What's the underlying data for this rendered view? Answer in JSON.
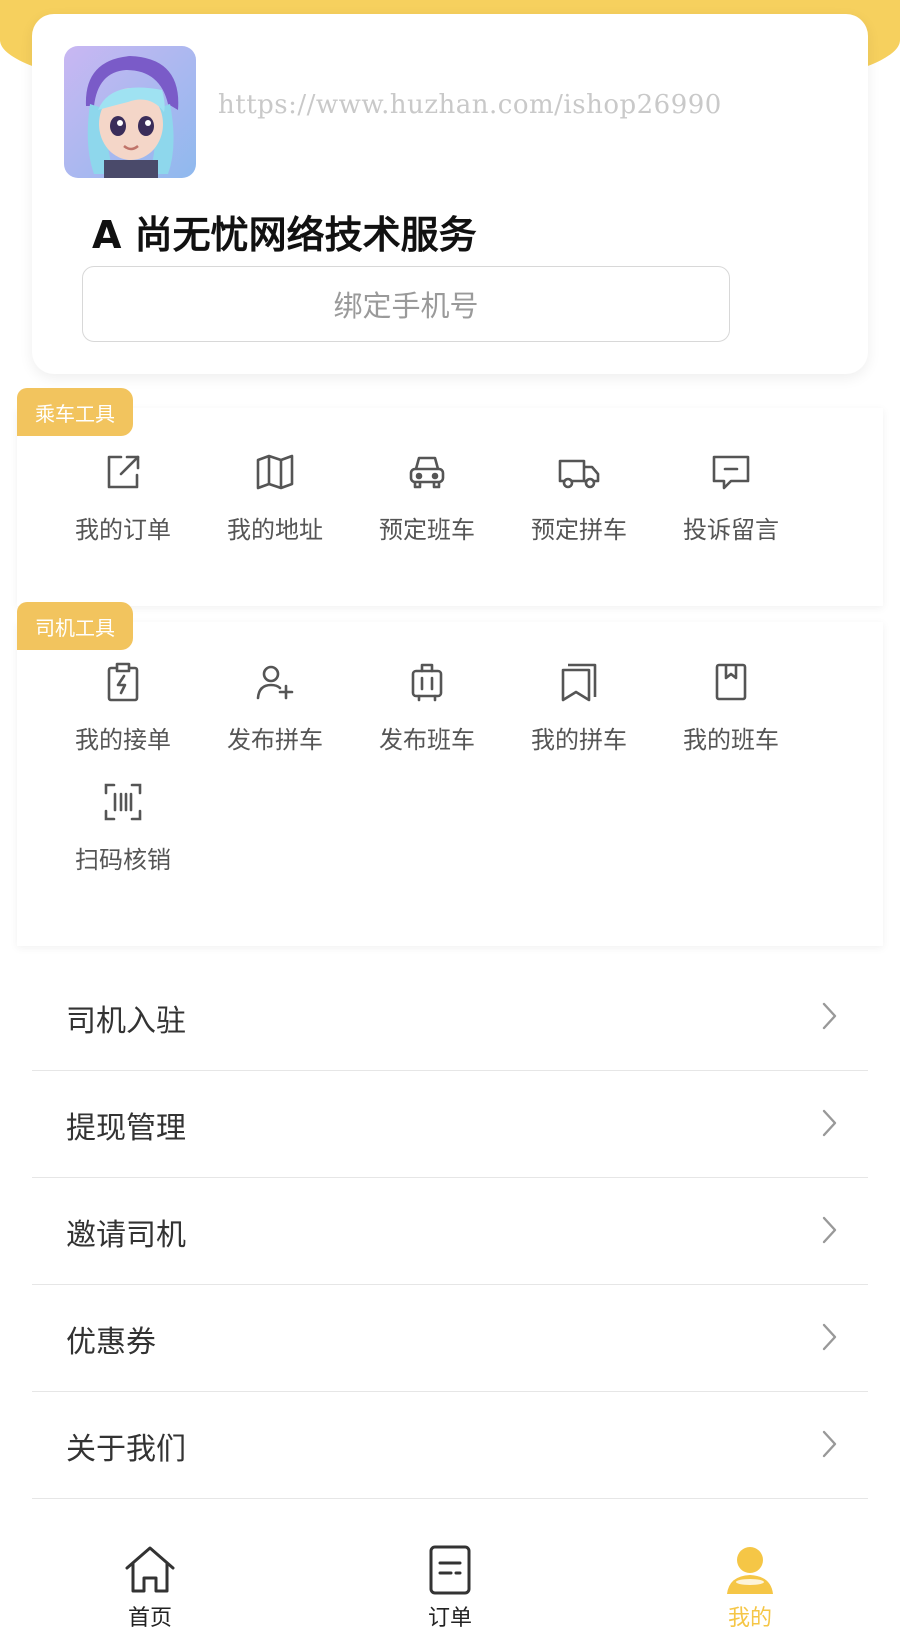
{
  "profile": {
    "watermark": "https://www.huzhan.com/ishop26990",
    "user_name": "A 尚无忧网络技术服务",
    "bind_phone_label": "绑定手机号"
  },
  "passenger_tools": {
    "title": "乘车工具",
    "items": [
      {
        "label": "我的订单",
        "icon": "external-link-icon"
      },
      {
        "label": "我的地址",
        "icon": "map-icon"
      },
      {
        "label": "预定班车",
        "icon": "car-icon"
      },
      {
        "label": "预定拼车",
        "icon": "truck-icon"
      },
      {
        "label": "投诉留言",
        "icon": "message-icon"
      }
    ]
  },
  "driver_tools": {
    "title": "司机工具",
    "items": [
      {
        "label": "我的接单",
        "icon": "clipboard-bolt-icon"
      },
      {
        "label": "发布拼车",
        "icon": "user-add-icon"
      },
      {
        "label": "发布班车",
        "icon": "luggage-icon"
      },
      {
        "label": "我的拼车",
        "icon": "bookmarks-icon"
      },
      {
        "label": "我的班车",
        "icon": "book-icon"
      },
      {
        "label": "扫码核销",
        "icon": "barcode-scan-icon"
      }
    ]
  },
  "menu": [
    {
      "label": "司机入驻"
    },
    {
      "label": "提现管理"
    },
    {
      "label": "邀请司机"
    },
    {
      "label": "优惠券"
    },
    {
      "label": "关于我们"
    }
  ],
  "bottom_nav": [
    {
      "label": "首页",
      "icon": "home-icon"
    },
    {
      "label": "订单",
      "icon": "order-icon"
    },
    {
      "label": "我的",
      "icon": "user-icon",
      "active": true
    }
  ],
  "colors": {
    "accent": "#f5c646",
    "badge": "#f2c45e",
    "header": "#f6d05e"
  }
}
